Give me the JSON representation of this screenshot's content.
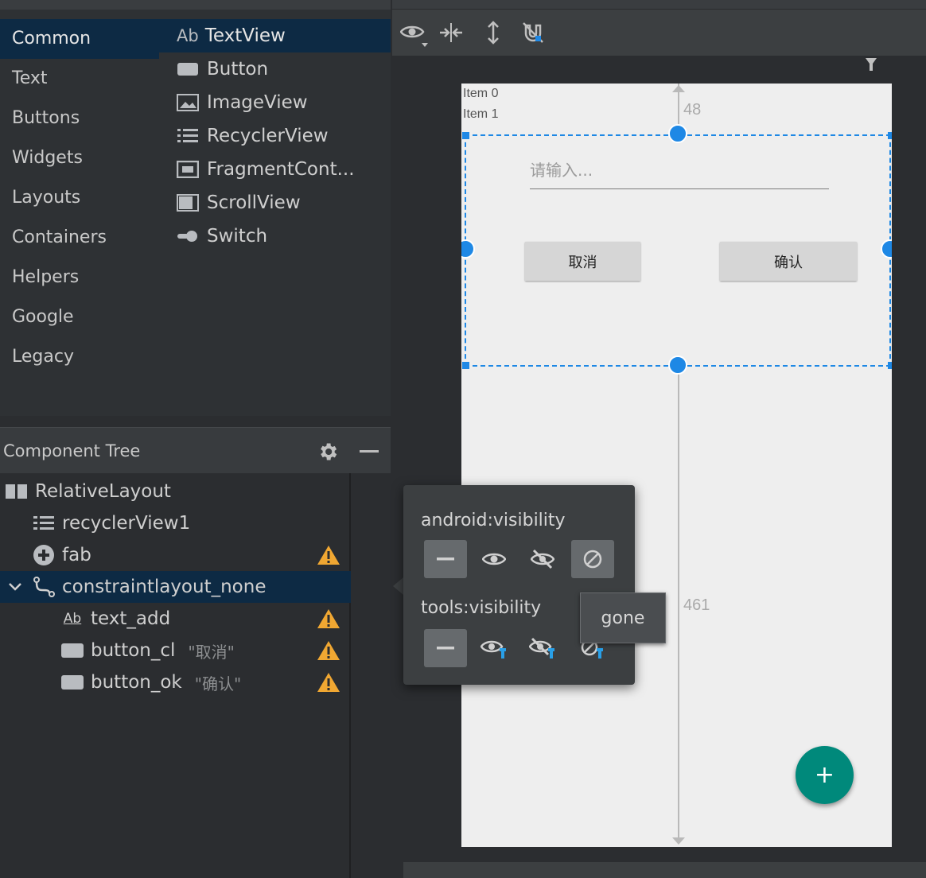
{
  "palette": {
    "categories": [
      "Common",
      "Text",
      "Buttons",
      "Widgets",
      "Layouts",
      "Containers",
      "Helpers",
      "Google",
      "Legacy"
    ],
    "widgets": [
      {
        "label": "TextView",
        "icon": "textview-icon",
        "icon_text": "Ab"
      },
      {
        "label": "Button",
        "icon": "button-icon"
      },
      {
        "label": "ImageView",
        "icon": "imageview-icon"
      },
      {
        "label": "RecyclerView",
        "icon": "recyclerview-icon"
      },
      {
        "label": "FragmentCont...",
        "icon": "fragment-container-icon"
      },
      {
        "label": "ScrollView",
        "icon": "scrollview-icon"
      },
      {
        "label": "Switch",
        "icon": "switch-icon"
      }
    ]
  },
  "component_tree": {
    "title": "Component Tree",
    "rows": [
      {
        "label": "RelativeLayout",
        "icon": "relative-layout-icon"
      },
      {
        "label": "recyclerView1",
        "icon": "recyclerview-icon"
      },
      {
        "label": "fab",
        "icon": "fab-icon",
        "warning": true
      },
      {
        "label": "constraintlayout_none",
        "icon": "constraint-layout-icon"
      },
      {
        "label": "text_add",
        "icon": "textview-icon",
        "icon_text": "Ab",
        "warning": true
      },
      {
        "label": "button_cl",
        "icon": "button-icon",
        "tag": "\"取消\"",
        "warning": true
      },
      {
        "label": "button_ok",
        "icon": "button-icon",
        "tag": "\"确认\"",
        "warning": true
      }
    ]
  },
  "device": {
    "list_items": [
      "Item 0",
      "Item 1"
    ],
    "edit_hint": "请输入...",
    "cancel_button": "取消",
    "ok_button": "确认",
    "top_margin": "48",
    "bottom_margin": "461",
    "fab_label": "+"
  },
  "visibility_popup": {
    "android_label": "android:visibility",
    "tools_label": "tools:visibility",
    "tooltip": "gone"
  },
  "colors": {
    "accent": "#1e88e5",
    "selection": "#0d2a44",
    "fab": "#00897b",
    "warning": "#f0a732"
  }
}
